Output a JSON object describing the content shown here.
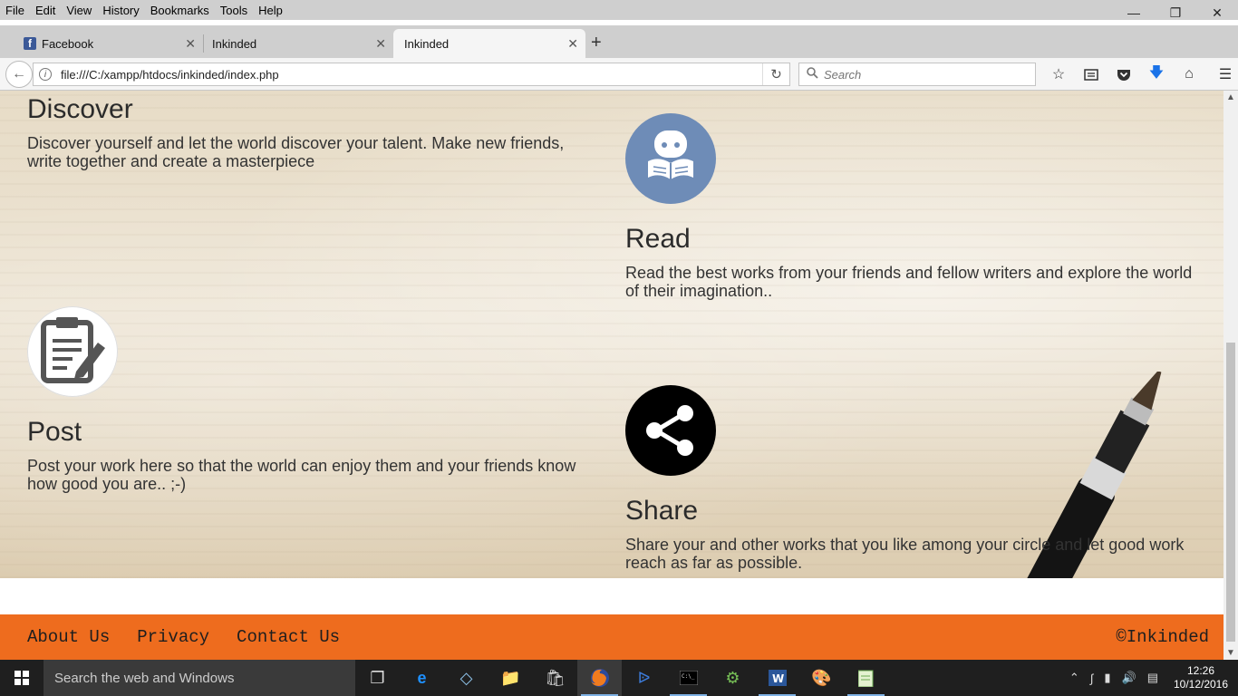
{
  "menubar": {
    "items": [
      "File",
      "Edit",
      "View",
      "History",
      "Bookmarks",
      "Tools",
      "Help"
    ]
  },
  "tabs": [
    {
      "label": "Facebook",
      "icon": "facebook-icon"
    },
    {
      "label": "Inkinded"
    },
    {
      "label": "Inkinded",
      "active": true
    }
  ],
  "nav": {
    "url": "file:///C:/xampp/htdocs/inkinded/index.php",
    "search_placeholder": "Search"
  },
  "features": {
    "discover": {
      "title": "Discover",
      "text": "Discover yourself and let the world discover your talent. Make new friends, write together and create a masterpiece"
    },
    "read": {
      "title": "Read",
      "text": "Read the best works from your friends and fellow writers and explore the world of their imagination..",
      "icon_color": "#6e8cb7"
    },
    "post": {
      "title": "Post",
      "text": "Post your work here so that the world can enjoy them and your friends know how good you are.. ;-)"
    },
    "share": {
      "title": "Share",
      "text": "Share your and other works that you like among your circle and let good work reach as far as possible."
    }
  },
  "footer": {
    "links": [
      "About Us",
      "Privacy",
      "Contact Us"
    ],
    "copyright": "©Inkinded",
    "color": "#ee6c1e"
  },
  "taskbar": {
    "search_text": "Search the web and Windows",
    "time": "12:26",
    "date": "10/12/2016"
  }
}
